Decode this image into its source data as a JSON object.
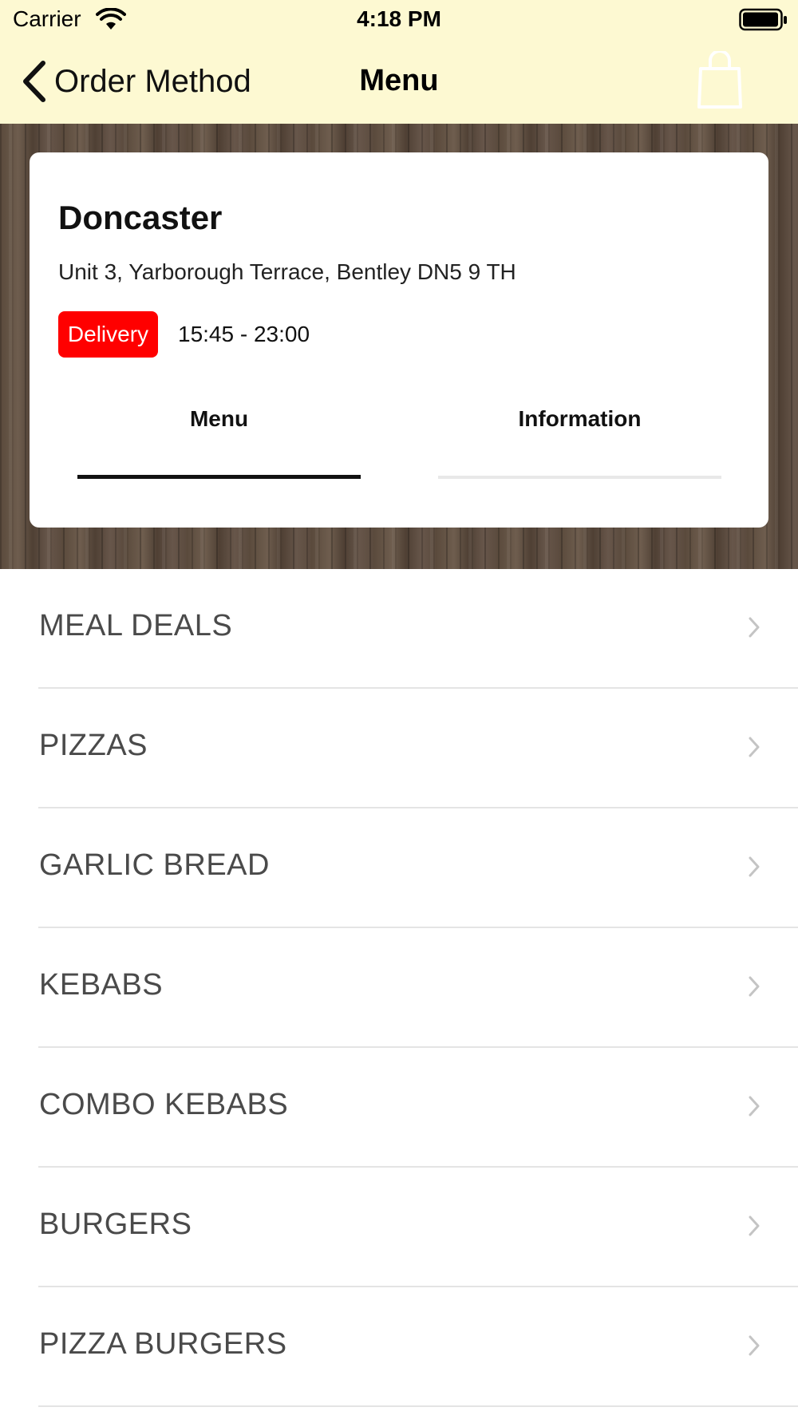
{
  "status_bar": {
    "carrier": "Carrier",
    "time": "4:18 PM"
  },
  "nav": {
    "back_label": "Order Method",
    "title": "Menu",
    "right_icon": "shopping-bag-icon"
  },
  "store": {
    "name": "Doncaster",
    "address": "Unit 3, Yarborough Terrace, Bentley DN5 9 TH",
    "order_type_badge": "Delivery",
    "hours": "15:45 - 23:00"
  },
  "tabs": [
    {
      "label": "Menu",
      "active": true
    },
    {
      "label": "Information",
      "active": false
    }
  ],
  "categories": [
    "MEAL DEALS",
    "PIZZAS",
    "GARLIC BREAD",
    "KEBABS",
    "COMBO KEBABS",
    "BURGERS",
    "PIZZA BURGERS"
  ],
  "colors": {
    "nav_background": "#fdf9d2",
    "badge": "#ff0000",
    "category_text": "#4a4a4a"
  }
}
